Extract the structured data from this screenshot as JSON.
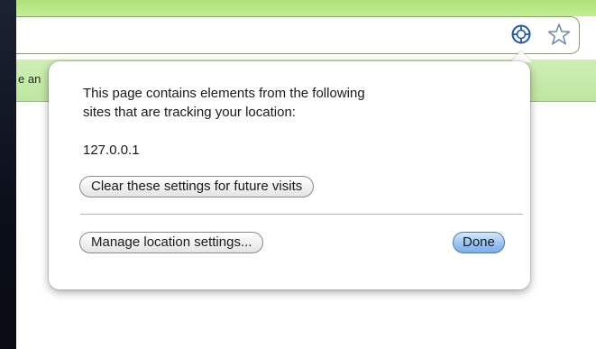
{
  "infobar": {
    "partial_text": "e an"
  },
  "toolbar": {
    "location_icon": "location-tracking-icon",
    "star_icon": "bookmark-star-icon"
  },
  "bubble": {
    "message_line1": "This page contains elements from the following",
    "message_line2": "sites that are tracking your location:",
    "host": "127.0.0.1",
    "clear_button": "Clear these settings for future visits",
    "manage_button": "Manage location settings...",
    "done_button": "Done"
  },
  "colors": {
    "infobar_green": "#c3ea9f",
    "done_blue": "#8dbbef"
  }
}
